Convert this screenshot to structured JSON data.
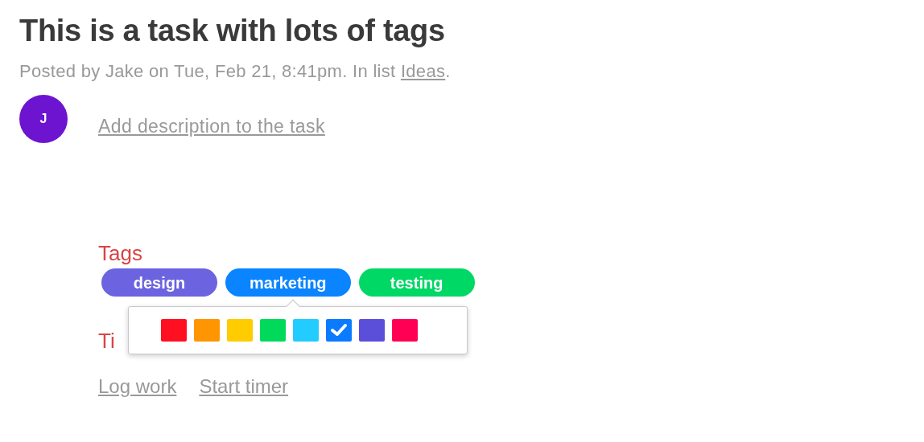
{
  "title": "This is a task with lots of tags",
  "meta": {
    "prefix": "Posted by Jake on Tue, Feb 21, 8:41pm. In list ",
    "link": "Ideas",
    "suffix": "."
  },
  "avatar": {
    "initial": "J",
    "color": "#6d14d0"
  },
  "description_link": "Add description to the task",
  "tags_heading": "Tags",
  "tags": [
    {
      "label": "design",
      "color": "#6b63e0"
    },
    {
      "label": "marketing",
      "color": "#0a84ff"
    },
    {
      "label": "testing",
      "color": "#00d866"
    }
  ],
  "color_picker": {
    "swatches": [
      {
        "color": "#ff1020",
        "selected": false
      },
      {
        "color": "#ff9500",
        "selected": false
      },
      {
        "color": "#ffcc00",
        "selected": false
      },
      {
        "color": "#00d95a",
        "selected": false
      },
      {
        "color": "#22ccff",
        "selected": false
      },
      {
        "color": "#0a7aff",
        "selected": true
      },
      {
        "color": "#5b4fd9",
        "selected": false
      },
      {
        "color": "#ff0055",
        "selected": false
      }
    ]
  },
  "timer_heading": "Ti",
  "actions": [
    "Log work",
    "Start timer"
  ]
}
